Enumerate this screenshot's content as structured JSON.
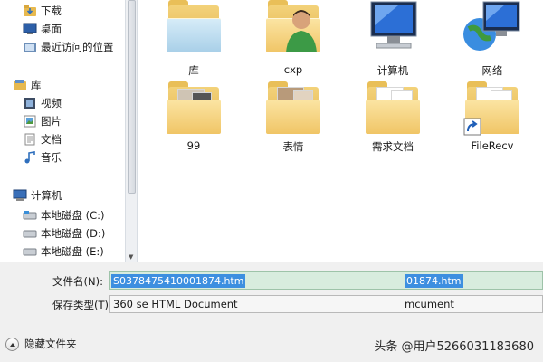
{
  "nav": {
    "items": [
      {
        "label": "下载",
        "icon": "download-folder-icon"
      },
      {
        "label": "桌面",
        "icon": "desktop-icon"
      },
      {
        "label": "最近访问的位置",
        "icon": "recent-places-icon"
      },
      {
        "label": "库",
        "icon": "library-icon"
      },
      {
        "label": "视频",
        "icon": "videos-icon"
      },
      {
        "label": "图片",
        "icon": "pictures-icon"
      },
      {
        "label": "文档",
        "icon": "documents-icon"
      },
      {
        "label": "音乐",
        "icon": "music-icon"
      },
      {
        "label": "计算机",
        "icon": "computer-icon"
      },
      {
        "label": "本地磁盘 (C:)",
        "icon": "drive-icon"
      },
      {
        "label": "本地磁盘 (D:)",
        "icon": "drive-icon"
      },
      {
        "label": "本地磁盘 (E:)",
        "icon": "drive-icon"
      }
    ]
  },
  "content": {
    "items": [
      {
        "label": "库",
        "icon": "library-folder-icon"
      },
      {
        "label": "cxp",
        "icon": "user-folder-icon"
      },
      {
        "label": "计算机",
        "icon": "computer-icon"
      },
      {
        "label": "网络",
        "icon": "network-icon"
      },
      {
        "label": "99",
        "icon": "folder-icon"
      },
      {
        "label": "表情",
        "icon": "folder-icon"
      },
      {
        "label": "需求文档",
        "icon": "folder-icon"
      },
      {
        "label": "FileRecv",
        "icon": "folder-shortcut-icon"
      }
    ]
  },
  "form": {
    "filename_label": "文件名(N):",
    "filename_value": "S0378475410001874.htm",
    "filename_dup": "01874.htm",
    "type_label": "保存类型(T):",
    "type_value": "360 se HTML Document",
    "type_dup": "mcument"
  },
  "footer": {
    "hide_folders": "隐藏文件夹",
    "watermark": "头条 @用户5266031183680"
  },
  "colors": {
    "selection": "#3d8fe0",
    "filename_bg": "#d8ecde",
    "folder": "#f0c566"
  }
}
